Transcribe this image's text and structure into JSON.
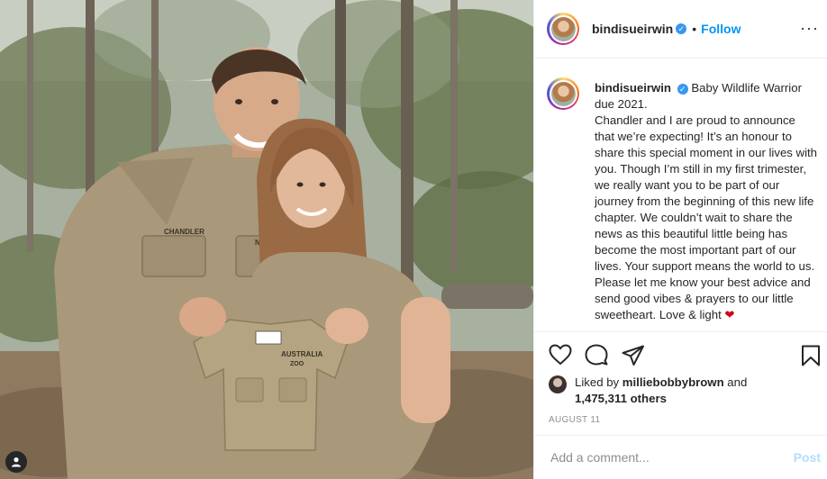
{
  "post": {
    "username": "bindisueirwin",
    "verified_mark": "✓",
    "separator": "•",
    "follow_label": "Follow",
    "more_label": "···",
    "caption": {
      "line1": "Baby Wildlife Warrior",
      "line2": "due 2021.",
      "body": "Chandler and I are proud to announce that we’re expecting! It’s an honour to share this special moment in our lives with you. Though I’m still in my first trimester, we really want you to be part of our journey from the beginning of this new life chapter. We couldn’t wait to share the news as this beautiful little being has become the most important part of our lives. Your support means the world to us. Please let me know your best advice and send good vibes & prayers to our little sweetheart. Love & light",
      "emoji": "❤"
    },
    "likes": {
      "prefix": "Liked by ",
      "liker": "milliebobbybrown",
      "connector": " and",
      "count": "1,475,311 others"
    },
    "date": "AUGUST 11",
    "comment": {
      "placeholder": "Add a comment...",
      "post_label": "Post"
    }
  },
  "photo": {
    "shirt_name_left": "CHANDLER",
    "shirt_name_right": "NE",
    "baby_shirt_text": "AUSTRALIA",
    "baby_shirt_text2": "ZOO"
  },
  "icons": {
    "like": "heart-icon",
    "comment": "comment-icon",
    "share": "share-icon",
    "save": "bookmark-icon",
    "tags": "user-tag-icon"
  }
}
